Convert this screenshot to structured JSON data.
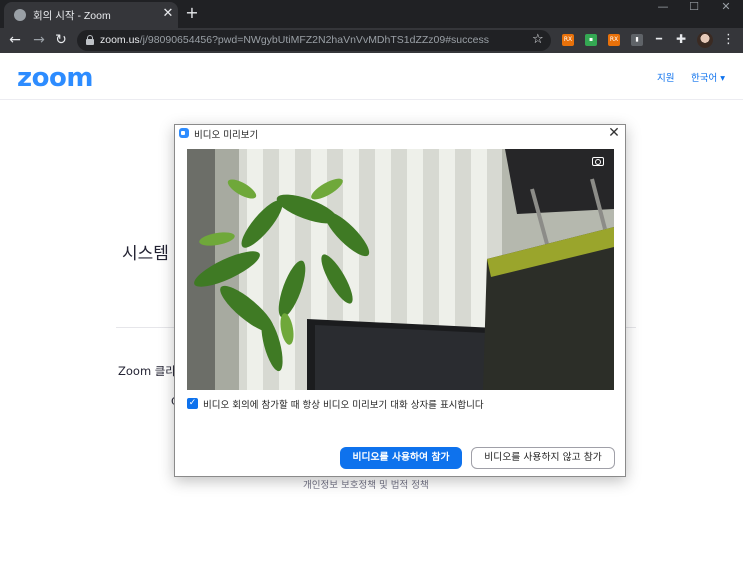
{
  "browser": {
    "tab_title": "회의 시작 - Zoom",
    "new_tab": "+",
    "url_host": "zoom.us",
    "url_path": "/j/98090654456?pwd=NWgybUtiMFZ2N2haVnVvMDhTS1dZZz09#success",
    "extensions": [
      {
        "name": "RX",
        "color": "#e8710a"
      },
      {
        "name": "",
        "color": "#34a853"
      },
      {
        "name": "RX",
        "color": "#e8710a"
      },
      {
        "name": "",
        "color": "#5f6368"
      },
      {
        "name": "",
        "color": "#202124"
      }
    ]
  },
  "page": {
    "logo": "zoom",
    "nav_support": "지원",
    "nav_language": "한국어 ▾",
    "heading_fragment": "시스템",
    "text_fragment": "Zoom 클라",
    "left_fragment": "C",
    "footer": "개인정보 보호정책 및 법적 정책"
  },
  "dialog": {
    "title": "비디오 미리보기",
    "close": "✕",
    "checkbox_label": "비디오 회의에 참가할 때 항상 비디오 미리보기 대화 상자를 표시합니다",
    "checkbox_checked": true,
    "join_with_video": "비디오를 사용하여 참가",
    "join_without_video": "비디오를 사용하지 않고 참가"
  }
}
